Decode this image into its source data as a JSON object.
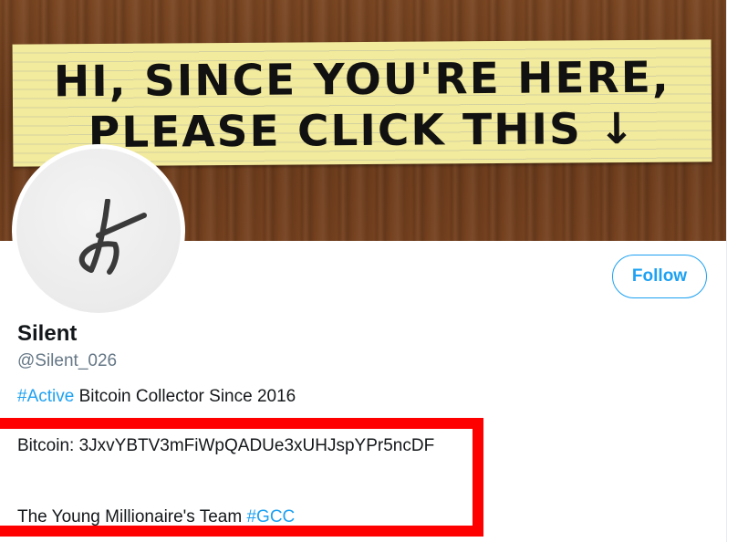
{
  "banner": {
    "line1": "HI, SINCE YOU'RE HERE,",
    "line2": "PLEASE CLICK THIS ↓"
  },
  "profile": {
    "display_name": "Silent",
    "handle": "@Silent_026",
    "follow_label": "Follow",
    "bio": {
      "line1_hashtag": "#Active",
      "line1_text": " Bitcoin Collector Since 2016",
      "line2_text": "Bitcoin: 3JxvYBTV3mFiWpQADUe3xUHJspYPr5ncDF",
      "line3_text": "The Young Millionaire's Team ",
      "line3_hashtag": "#GCC"
    }
  },
  "icons": {
    "avatar": "signature-glyph-icon"
  },
  "colors": {
    "accent": "#1da1f2",
    "text": "#14171a",
    "muted": "#657786",
    "highlight": "#ff0000",
    "note": "#f2ea9c",
    "wood": "#6e3f1f"
  }
}
